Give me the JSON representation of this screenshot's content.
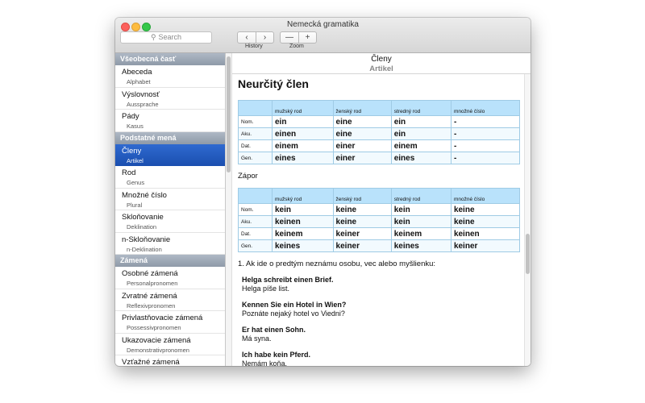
{
  "window": {
    "title": "Nemecká gramatika"
  },
  "toolbar": {
    "search_placeholder": "Search",
    "history_label": "History",
    "zoom_label": "Zoom",
    "back_glyph": "‹",
    "forward_glyph": "›",
    "zoom_out_glyph": "—",
    "zoom_in_glyph": "+"
  },
  "sidebar": {
    "sections": [
      {
        "header": "Všeobecná časť",
        "items": [
          {
            "label": "Abeceda",
            "sub": "Alphabet"
          },
          {
            "label": "Výslovnosť",
            "sub": "Aussprache"
          },
          {
            "label": "Pády",
            "sub": "Kasus"
          }
        ]
      },
      {
        "header": "Podstatné mená",
        "items": [
          {
            "label": "Členy",
            "sub": "Artikel",
            "selected": true
          },
          {
            "label": "Rod",
            "sub": "Genus"
          },
          {
            "label": "Množné číslo",
            "sub": "Plural"
          },
          {
            "label": "Skloňovanie",
            "sub": "Deklination"
          },
          {
            "label": "n-Skloňovanie",
            "sub": "n-Deklination"
          }
        ]
      },
      {
        "header": "Zámená",
        "items": [
          {
            "label": "Osobné zámená",
            "sub": "Personalpronomen"
          },
          {
            "label": "Zvratné zámená",
            "sub": "Reflexivpronomen"
          },
          {
            "label": "Privlastňovacie zámená",
            "sub": "Possessivpronomen"
          },
          {
            "label": "Ukazovacie zámená",
            "sub": "Demonstrativpronomen"
          },
          {
            "label": "Vzťažné zámená",
            "sub": ""
          }
        ]
      }
    ]
  },
  "content": {
    "title": "Členy",
    "subtitle": "Artikel",
    "heading": "Neurčitý člen",
    "table1": {
      "headers": [
        "mužský rod",
        "ženský rod",
        "stredný rod",
        "množné číslo"
      ],
      "rows": [
        {
          "case": "Nom.",
          "cells": [
            "ein",
            "eine",
            "ein",
            "-"
          ]
        },
        {
          "case": "Aku.",
          "cells": [
            "einen",
            "eine",
            "ein",
            "-"
          ]
        },
        {
          "case": "Dat.",
          "cells": [
            "einem",
            "einer",
            "einem",
            "-"
          ]
        },
        {
          "case": "Gen.",
          "cells": [
            "eines",
            "einer",
            "eines",
            "-"
          ]
        }
      ]
    },
    "zapor_label": "Zápor",
    "table2": {
      "headers": [
        "mužský rod",
        "ženský rod",
        "stredný rod",
        "množné číslo"
      ],
      "rows": [
        {
          "case": "Nom.",
          "cells": [
            "kein",
            "keine",
            "kein",
            "keine"
          ]
        },
        {
          "case": "Aku.",
          "cells": [
            "keinen",
            "keine",
            "kein",
            "keine"
          ]
        },
        {
          "case": "Dat.",
          "cells": [
            "keinem",
            "keiner",
            "keinem",
            "keinen"
          ]
        },
        {
          "case": "Gen.",
          "cells": [
            "keines",
            "keiner",
            "keines",
            "keiner"
          ]
        }
      ]
    },
    "rule1": "1. Ak ide o predtým neznámu osobu, vec alebo myšlienku:",
    "examples": [
      {
        "de": "Helga schreibt einen Brief.",
        "sk": "Helga píše list."
      },
      {
        "de": "Kennen Sie ein Hotel in Wien?",
        "sk": "Poznáte nejaký hotel vo Viedni?"
      },
      {
        "de": "Er hat einen Sohn.",
        "sk": "Má syna."
      },
      {
        "de": "Ich habe kein Pferd.",
        "sk": "Nemám koňa."
      }
    ]
  }
}
